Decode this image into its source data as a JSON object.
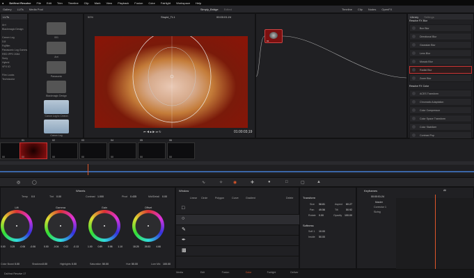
{
  "menubar": {
    "app": "DaVinci Resolve",
    "items": [
      "File",
      "Edit",
      "Trim",
      "Timeline",
      "Clip",
      "Mark",
      "View",
      "Playback",
      "Fusion",
      "Color",
      "Fairlight",
      "Workspace",
      "Help"
    ]
  },
  "toolbar": {
    "gallery": "Gallery",
    "lut": "LUTs",
    "media_pool": "Media Pool",
    "project_title": "Simply_Bridge",
    "edited": "Edited",
    "clip": "Clip",
    "timeline": "Timeline",
    "clip2": "Clip",
    "nodes": "Nodes",
    "fx": "Effects",
    "openfx": "OpenFX",
    "zoom": "50%",
    "tl_name": "Stupid_TL1",
    "timecode_top": "00:00:01:24"
  },
  "lut_panel": {
    "title": "LUTs",
    "items": [
      "",
      "Arri",
      "Blackmagic Design",
      "",
      "Canon Log",
      "DJI",
      "Fujifilm",
      "Panasonic Log Gamma",
      "RED IPP2 2084",
      "Sony",
      "Hybrid",
      "VFX IO",
      "",
      "Film Looks",
      "Technicolor"
    ]
  },
  "lut_thumbs": [
    {
      "label": "001"
    },
    {
      "label": "Arri"
    },
    {
      "label": "Panasonic"
    },
    {
      "label": "Blackmagic Design"
    },
    {
      "label": "Canon Log to Cineon"
    },
    {
      "label": "Canon Log"
    }
  ],
  "viewer": {
    "timecode": "01:00:03;19"
  },
  "node": {
    "label": "01"
  },
  "library": {
    "tab1": "Library",
    "tab2": "Settings",
    "section1": "Resolve FX Blur",
    "blur_items": [
      "Box Blur",
      "Directional Blur",
      "Gaussian Blur",
      "Lens Blur",
      "Mosaic Blur",
      "Radial Blur",
      "Zoom Blur"
    ],
    "selected": "Radial Blur",
    "section2": "Resolve FX Color",
    "color_items": [
      "ACES Transform",
      "Chromatic Adaptation",
      "Color Compressor",
      "Color Space Transform",
      "Color Stabilizer",
      "Contrast Pop",
      "DCTL"
    ]
  },
  "clips": [
    {
      "num": "01",
      "dur": "00"
    },
    {
      "num": "02",
      "dur": "00"
    },
    {
      "num": "03",
      "dur": "00"
    },
    {
      "num": "04",
      "dur": "00"
    },
    {
      "num": "05",
      "dur": "00"
    },
    {
      "num": "06",
      "dur": "00"
    },
    {
      "num": "07",
      "dur": "00"
    }
  ],
  "wheels": {
    "title": "Wheels",
    "temp_label": "Temp",
    "temp": "0.0",
    "tint_label": "Tint",
    "tint": "0.00",
    "contrast_label": "Contrast",
    "contrast": "1.000",
    "pivot_label": "Pivot",
    "pivot": "0.435",
    "md_label": "Mid/Detail",
    "md": "0.00",
    "lift": {
      "label": "Lift",
      "vals": [
        "0.00",
        "0.25",
        "-0.06",
        "-0.06"
      ]
    },
    "gamma": {
      "label": "Gamma",
      "vals": [
        "0.00",
        "-0.04",
        "0.02",
        "-0.13"
      ]
    },
    "gain": {
      "label": "Gain",
      "vals": [
        "1.00",
        "0.89",
        "0.98",
        "1.10"
      ]
    },
    "offset": {
      "label": "Offset",
      "vals": [
        "18.25",
        "26.53",
        "4.66",
        ""
      ]
    },
    "colorboost_label": "Color Boost",
    "colorboost": "0.00",
    "shadows_label": "Shadows",
    "shadows": "0.00",
    "highlights_label": "Highlights",
    "highlights": "0.00",
    "sat_label": "Saturation",
    "sat": "50.00",
    "hue_label": "Hue",
    "hue": "50.00",
    "lm_label": "Lum Mix",
    "lm": "100.00"
  },
  "window": {
    "title": "Window",
    "tools": [
      "Linear",
      "Circle",
      "Polygon",
      "Curve",
      "Gradient"
    ],
    "delete": "Delete"
  },
  "transform": {
    "title": "Transform",
    "size_label": "Size",
    "size": "58.81",
    "aspect_label": "Aspect",
    "aspect": "60.27",
    "pan_label": "Pan",
    "pan": "49.56",
    "tilt_label": "Tilt",
    "tilt": "50.92",
    "rotate_label": "Rotate",
    "rotate": "0.00",
    "opacity_label": "Opacity",
    "opacity": "100.00",
    "softness_title": "Softness",
    "soft1_label": "Soft 1",
    "soft1": "10.00",
    "inside_label": "Inside",
    "inside": "50.00"
  },
  "keyframes": {
    "title": "Keyframes",
    "filter": "All",
    "timecode": "00:00:01:24",
    "master": "Master",
    "corrector": "Corrector 1",
    "sizing": "Sizing"
  },
  "page_tabs": [
    "Media",
    "Edit",
    "Fusion",
    "Color",
    "Fairlight",
    "Deliver"
  ],
  "project_name": "DaVinci Resolve 17",
  "colors": {
    "accent": "#e0572a",
    "selection": "#b82323"
  }
}
